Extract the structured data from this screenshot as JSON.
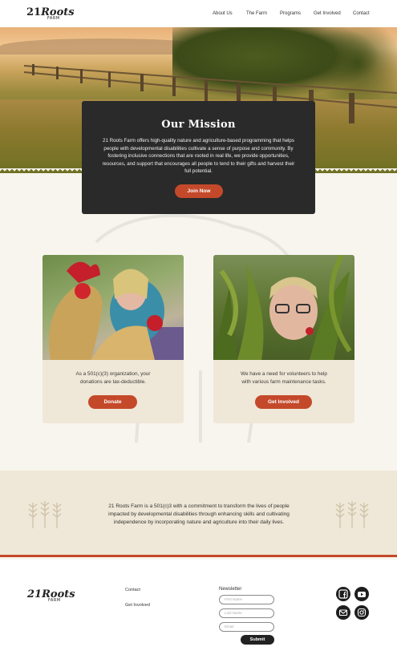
{
  "header": {
    "logo_num": "21",
    "logo_word": "Roots",
    "logo_sub": "FARM",
    "nav": [
      "About Us",
      "The Farm",
      "Programs",
      "Get Involved",
      "Contact"
    ]
  },
  "mission": {
    "title": "Our Mission",
    "body": "21 Roots Farm offers high-quality nature and agriculture-based programming that helps people with developmental disabilities cultivate a sense of purpose and community. By fostering inclusive connections that are rooted in real life, we provide opportunities, resources, and support that encourages all people to tend to their gifts and harvest their full potential.",
    "button": "Join Now"
  },
  "cards": [
    {
      "text": "As a 501(c)(3) organization, your donations are tax-deductible.",
      "button": "Donate"
    },
    {
      "text": "We have a need for volunteers to help with various farm maintenance tasks.",
      "button": "Get Involved"
    }
  ],
  "statement": "21 Roots Farm is a 501(c)3 with a commitment to transform the lives of people impacted by developmental disabilities through enhancing skills and cultivating independence by incorporating nature and agriculture into their daily lives.",
  "footer": {
    "links": [
      "Contact",
      "Get Involved"
    ],
    "newsletter_title": "Newsletter",
    "fields": [
      "First Name",
      "Last Name",
      "Email"
    ],
    "submit": "Submit",
    "social": [
      "facebook-icon",
      "youtube-icon",
      "mail-icon",
      "instagram-icon"
    ]
  },
  "colors": {
    "accent": "#c4492a",
    "dark": "#2a2a2a",
    "cream": "#efe7d7"
  }
}
